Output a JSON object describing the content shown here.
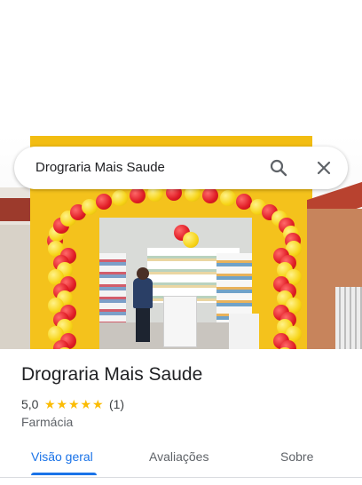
{
  "search": {
    "query": "Drograria Mais Saude",
    "search_icon": "search-icon",
    "close_icon": "close-icon"
  },
  "place": {
    "name": "Drograria Mais Saude",
    "rating": "5,0",
    "stars": 5,
    "review_count": "(1)",
    "category": "Farmácia"
  },
  "tabs": [
    {
      "label": "Visão geral",
      "active": true
    },
    {
      "label": "Avaliações",
      "active": false
    },
    {
      "label": "Sobre",
      "active": false
    }
  ],
  "colors": {
    "accent": "#1a73e8",
    "star": "#fbbc04",
    "text_primary": "#202124",
    "text_secondary": "#5f6368"
  }
}
